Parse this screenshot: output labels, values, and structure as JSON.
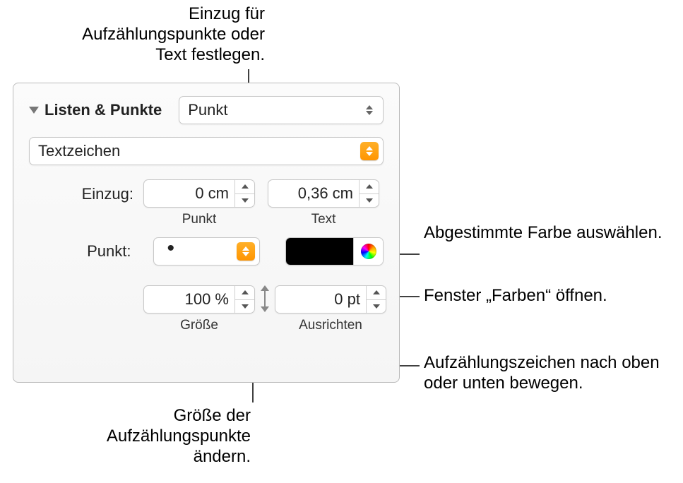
{
  "annotations": {
    "top": "Einzug für Aufzählungspunkte oder Text festlegen.",
    "color": "Abgestimmte Farbe auswählen.",
    "picker": "Fenster „Farben“ öffnen.",
    "align": "Aufzählungszeichen nach oben oder unten bewegen.",
    "size": "Größe der Aufzählungspunkte ändern."
  },
  "section": {
    "title": "Listen & Punkte",
    "style_value": "Punkt"
  },
  "format_value": "Textzeichen",
  "indent": {
    "label": "Einzug:",
    "bullet": {
      "value": "0 cm",
      "sublabel": "Punkt"
    },
    "text": {
      "value": "0,36 cm",
      "sublabel": "Text"
    }
  },
  "bullet_row": {
    "label": "Punkt:",
    "glyph": "•"
  },
  "size": {
    "value": "100 %",
    "label": "Größe"
  },
  "align": {
    "value": "0 pt",
    "label": "Ausrichten"
  },
  "color": "#000000"
}
